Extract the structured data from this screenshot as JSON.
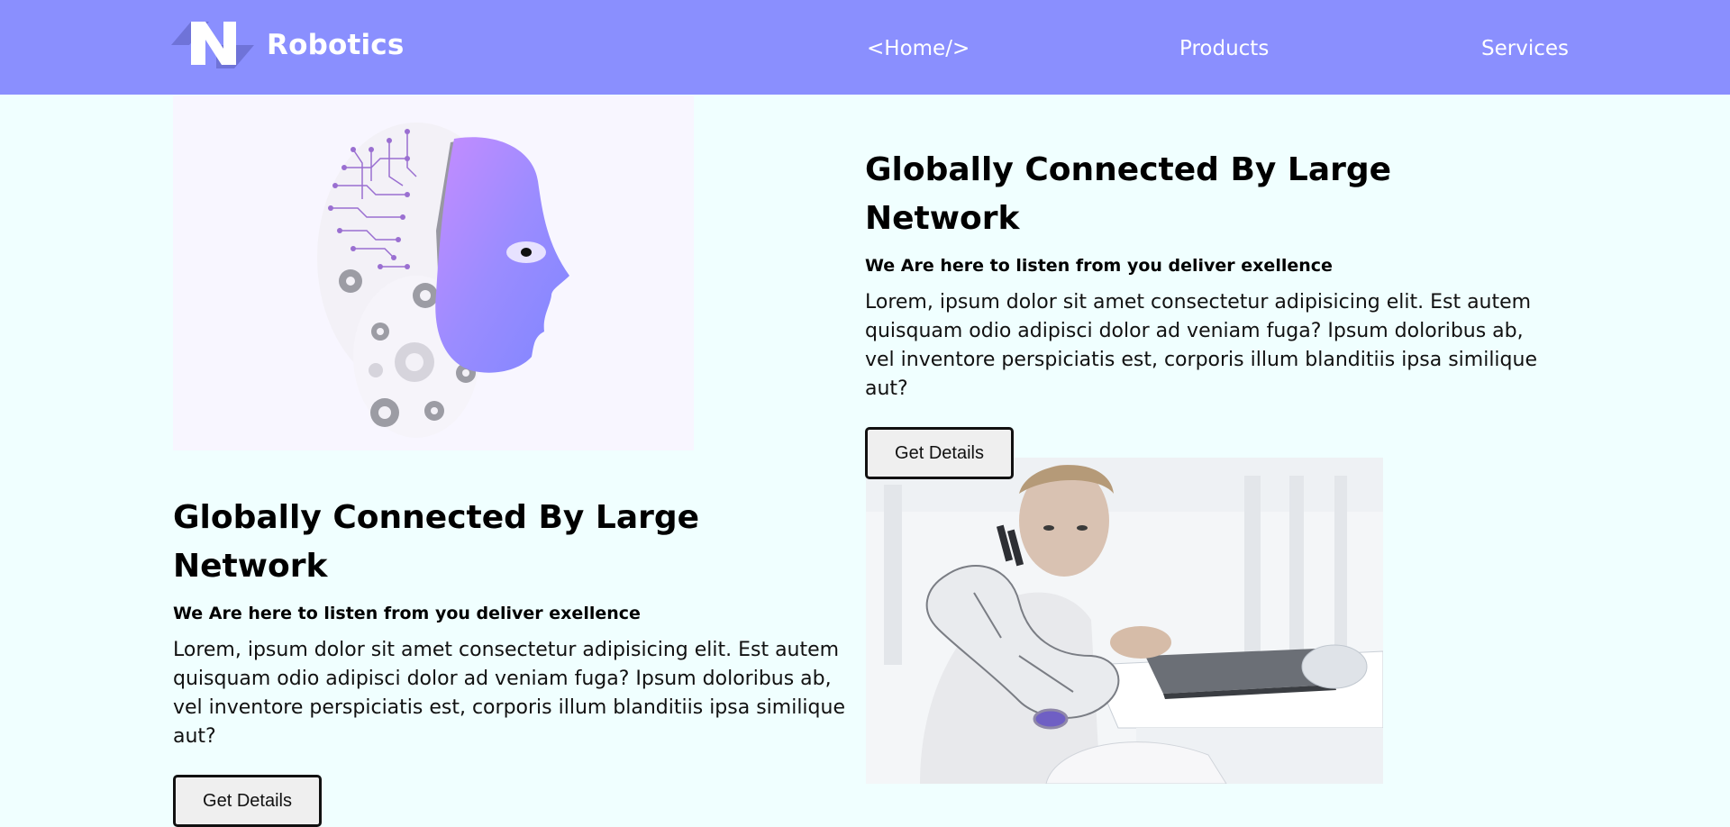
{
  "brand": {
    "name": "Robotics",
    "logo_icon": "robotics-logo-icon"
  },
  "nav": {
    "home": "<Home/>",
    "products": "Products",
    "services": "Services"
  },
  "colors": {
    "navbar": "#8a8ffe",
    "page_background": "#f0ffff",
    "accent_purple": "#a88bff"
  },
  "features": [
    {
      "title": "Globally Connected By Large Network",
      "subtitle": "We Are here to listen from you deliver exellence",
      "body": "Lorem, ipsum dolor sit amet consectetur adipisicing elit. Est autem quisquam odio adipisci dolor ad veniam fuga? Ipsum doloribus ab, vel inventore perspiciatis est, corporis illum blanditiis ipsa similique aut?",
      "button": "Get Details"
    },
    {
      "title": "Globally Connected By Large Network",
      "subtitle": "We Are here to listen from you deliver exellence",
      "body": "Lorem, ipsum dolor sit amet consectetur adipisicing elit. Est autem quisquam odio adipisci dolor ad veniam fuga? Ipsum doloribus ab, vel inventore perspiciatis est, corporis illum blanditiis ipsa similique aut?",
      "button": "Get Details"
    }
  ],
  "images": {
    "robot_head": "robot-head-illustration",
    "cyborg_photo": "cyborg-arm-photo"
  }
}
